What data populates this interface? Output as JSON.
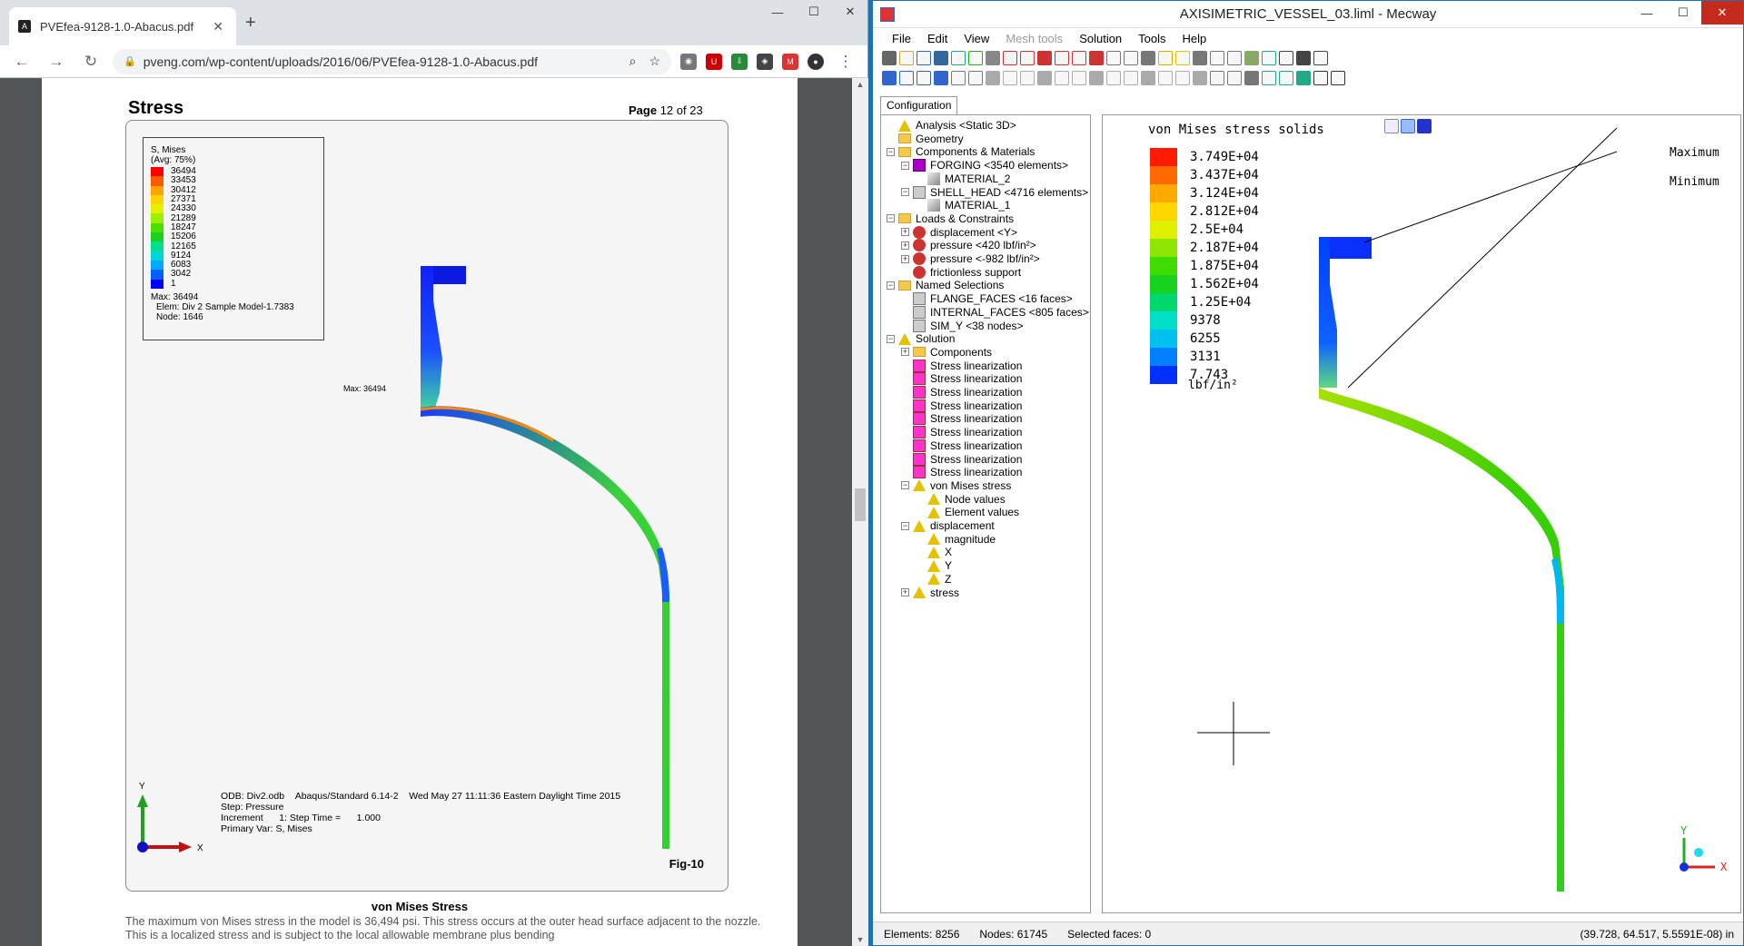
{
  "browser": {
    "tab_title": "PVEfea-9128-1.0-Abacus.pdf",
    "tab_close": "✕",
    "new_tab": "+",
    "url": "pveng.com/wp-content/uploads/2016/06/PVEfea-9128-1.0-Abacus.pdf",
    "win_min": "—",
    "win_max": "☐",
    "win_close": "✕"
  },
  "pdf": {
    "title": "Stress",
    "page_label": "Page",
    "page_num": "12 of 23",
    "legend_title": "S, Mises",
    "legend_avg": "(Avg: 75%)",
    "legend_values": [
      "36494",
      "33453",
      "30412",
      "27371",
      "24330",
      "21289",
      "18247",
      "15206",
      "12165",
      "9124",
      "6083",
      "3042",
      "1"
    ],
    "legend_colors": [
      "#ff0000",
      "#ff5a00",
      "#ffa500",
      "#ffd200",
      "#e2f200",
      "#9cf000",
      "#4be000",
      "#1ed01e",
      "#00e08c",
      "#00d6d6",
      "#00a8ff",
      "#0060ff",
      "#0000ff"
    ],
    "legend_max": "Max: 36494",
    "legend_elem": "Elem: Div 2 Sample Model-1.7383",
    "legend_node": "Node: 1646",
    "max_marker": "Max: 36494",
    "axis_y": "Y",
    "axis_x": "X",
    "info_odb": "ODB: Div2.odb",
    "info_solver": "Abaqus/Standard 6.14-2",
    "info_date": "Wed May 27 11:11:36 Eastern Daylight Time 2015",
    "info_step": "Step: Pressure",
    "info_increment": "Increment      1: Step Time =      1.000",
    "info_primary": "Primary Var: S, Mises",
    "fig_label": "Fig-10",
    "caption": "von Mises Stress",
    "paragraph": "The maximum von Mises stress in the model is 36,494 psi.  This stress occurs at the outer head surface adjacent to the nozzle.  This is a localized stress and is subject to the local allowable membrane plus bending"
  },
  "mecway": {
    "title": "AXISIMETRIC_VESSEL_03.liml - Mecway",
    "menus": [
      "File",
      "Edit",
      "View",
      "Mesh tools",
      "Solution",
      "Tools",
      "Help"
    ],
    "config_tab": "Configuration",
    "tree": [
      {
        "label": "Analysis <Static 3D>",
        "level": 0,
        "icon": "warn",
        "exp": ""
      },
      {
        "label": "Geometry",
        "level": 0,
        "icon": "folder",
        "exp": ""
      },
      {
        "label": "Components & Materials",
        "level": 0,
        "icon": "folder",
        "exp": "−"
      },
      {
        "label": "FORGING <3540 elements>",
        "level": 1,
        "icon": "comp",
        "exp": "−"
      },
      {
        "label": "MATERIAL_2",
        "level": 2,
        "icon": "mat",
        "exp": ""
      },
      {
        "label": "SHELL_HEAD <4716 elements>",
        "level": 1,
        "icon": "sel",
        "exp": "−"
      },
      {
        "label": "MATERIAL_1",
        "level": 2,
        "icon": "mat",
        "exp": ""
      },
      {
        "label": "Loads & Constraints",
        "level": 0,
        "icon": "folder",
        "exp": "−"
      },
      {
        "label": "displacement <Y>",
        "level": 1,
        "icon": "load",
        "exp": "+"
      },
      {
        "label": "pressure <420 lbf/in²>",
        "level": 1,
        "icon": "load",
        "exp": "+"
      },
      {
        "label": "pressure <-982 lbf/in²>",
        "level": 1,
        "icon": "load",
        "exp": "+"
      },
      {
        "label": "frictionless support",
        "level": 1,
        "icon": "load",
        "exp": ""
      },
      {
        "label": "Named Selections",
        "level": 0,
        "icon": "folder",
        "exp": "−"
      },
      {
        "label": "FLANGE_FACES <16 faces>",
        "level": 1,
        "icon": "sel",
        "exp": ""
      },
      {
        "label": "INTERNAL_FACES <805 faces>",
        "level": 1,
        "icon": "sel",
        "exp": ""
      },
      {
        "label": "SIM_Y <38 nodes>",
        "level": 1,
        "icon": "sel",
        "exp": ""
      },
      {
        "label": "Solution",
        "level": 0,
        "icon": "warn",
        "exp": "−"
      },
      {
        "label": "Components",
        "level": 1,
        "icon": "folder",
        "exp": "+"
      },
      {
        "label": "Stress linearization",
        "level": 1,
        "icon": "lin",
        "exp": ""
      },
      {
        "label": "Stress linearization",
        "level": 1,
        "icon": "lin",
        "exp": ""
      },
      {
        "label": "Stress linearization",
        "level": 1,
        "icon": "lin",
        "exp": ""
      },
      {
        "label": "Stress linearization",
        "level": 1,
        "icon": "lin",
        "exp": ""
      },
      {
        "label": "Stress linearization",
        "level": 1,
        "icon": "lin",
        "exp": ""
      },
      {
        "label": "Stress linearization",
        "level": 1,
        "icon": "lin",
        "exp": ""
      },
      {
        "label": "Stress linearization",
        "level": 1,
        "icon": "lin",
        "exp": ""
      },
      {
        "label": "Stress linearization",
        "level": 1,
        "icon": "lin",
        "exp": ""
      },
      {
        "label": "Stress linearization",
        "level": 1,
        "icon": "lin",
        "exp": ""
      },
      {
        "label": "von Mises stress",
        "level": 1,
        "icon": "warn",
        "exp": "−"
      },
      {
        "label": "Node values",
        "level": 2,
        "icon": "warn",
        "exp": ""
      },
      {
        "label": "Element values",
        "level": 2,
        "icon": "warn",
        "exp": ""
      },
      {
        "label": "displacement",
        "level": 1,
        "icon": "warn",
        "exp": "−"
      },
      {
        "label": "magnitude",
        "level": 2,
        "icon": "warn",
        "exp": ""
      },
      {
        "label": "X",
        "level": 2,
        "icon": "warn",
        "exp": ""
      },
      {
        "label": "Y",
        "level": 2,
        "icon": "warn",
        "exp": ""
      },
      {
        "label": "Z",
        "level": 2,
        "icon": "warn",
        "exp": ""
      },
      {
        "label": "stress",
        "level": 1,
        "icon": "warn",
        "exp": "+"
      }
    ],
    "view_title": "von Mises stress solids",
    "legend_values": [
      "3.749E+04",
      "3.437E+04",
      "3.124E+04",
      "2.812E+04",
      "2.5E+04",
      "2.187E+04",
      "1.875E+04",
      "1.562E+04",
      "1.25E+04",
      "9378",
      "6255",
      "3131",
      "7.743"
    ],
    "legend_colors": [
      "#ff1a00",
      "#ff6a00",
      "#ffa800",
      "#ffd600",
      "#dff000",
      "#8ee600",
      "#3fdc00",
      "#17d21e",
      "#00d86e",
      "#00e0c8",
      "#00c0f0",
      "#0080ff",
      "#0030ff"
    ],
    "unit": "lbf/in²",
    "maximum_label": "Maximum",
    "minimum_label": "Minimum",
    "axis_y": "Y",
    "axis_x": "X",
    "status_elements": "Elements: 8256",
    "status_nodes": "Nodes: 61745",
    "status_faces": "Selected faces: 0",
    "status_coords": "(39.728, 64.517, 5.5591E-08) in",
    "win_min": "—",
    "win_max": "☐",
    "win_close": "✕"
  }
}
